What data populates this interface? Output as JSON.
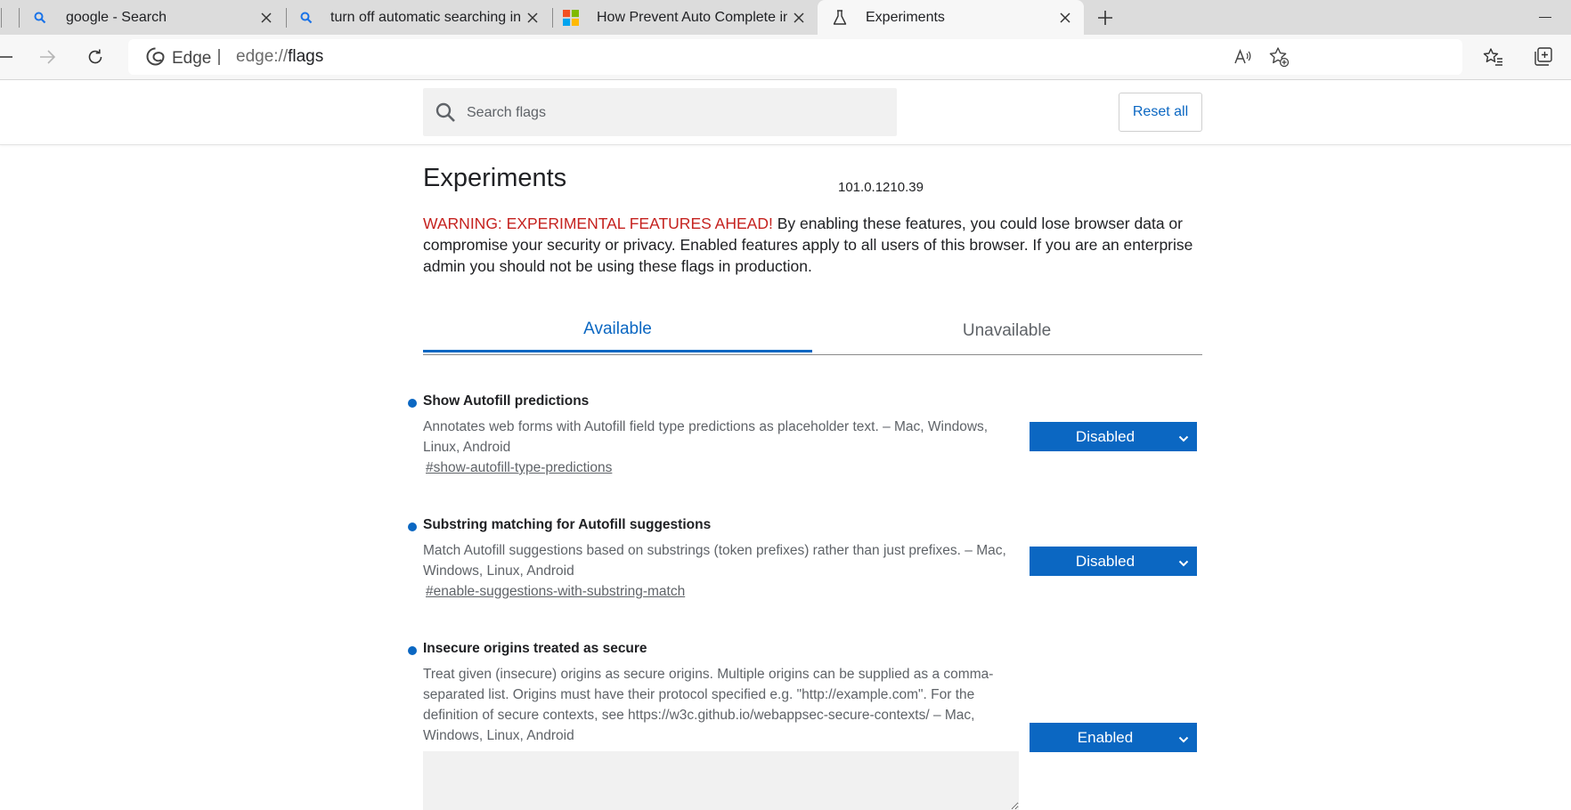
{
  "tabs": [
    {
      "title": "google - Search",
      "icon": "search-icon"
    },
    {
      "title": "turn off automatic searching in e",
      "icon": "search-icon"
    },
    {
      "title": "How Prevent Auto Complete in N",
      "icon": "microsoft-logo-icon"
    },
    {
      "title": "Experiments",
      "icon": "flask-icon"
    }
  ],
  "omnibox": {
    "brand": "Edge",
    "url_scheme": "edge://",
    "url_host": "flags"
  },
  "flags_header": {
    "search_placeholder": "Search flags",
    "reset_label": "Reset all"
  },
  "page": {
    "title": "Experiments",
    "version": "101.0.1210.39",
    "warning_head": "WARNING: EXPERIMENTAL FEATURES AHEAD!",
    "warning_body": " By enabling these features, you could lose browser data or compromise your security or privacy. Enabled features apply to all users of this browser. If you are an enterprise admin you should not be using these flags in production.",
    "tab_available": "Available",
    "tab_unavailable": "Unavailable"
  },
  "flags": [
    {
      "name": "Show Autofill predictions",
      "description": "Annotates web forms with Autofill field type predictions as placeholder text. – Mac, Windows, Linux, Android",
      "link": "#show-autofill-type-predictions",
      "value": "Disabled"
    },
    {
      "name": "Substring matching for Autofill suggestions",
      "description": "Match Autofill suggestions based on substrings (token prefixes) rather than just prefixes. – Mac, Windows, Linux, Android",
      "link": "#enable-suggestions-with-substring-match",
      "value": "Disabled"
    },
    {
      "name": "Insecure origins treated as secure",
      "description": "Treat given (insecure) origins as secure origins. Multiple origins can be supplied as a comma-separated list. Origins must have their protocol specified e.g. \"http://example.com\". For the definition of secure contexts, see https://w3c.github.io/webappsec-secure-contexts/ – Mac, Windows, Linux, Android",
      "value": "Enabled"
    }
  ],
  "colors": {
    "accent": "#0b67c2",
    "warning": "#c5221f",
    "tabstrip": "#dcdcdc"
  }
}
